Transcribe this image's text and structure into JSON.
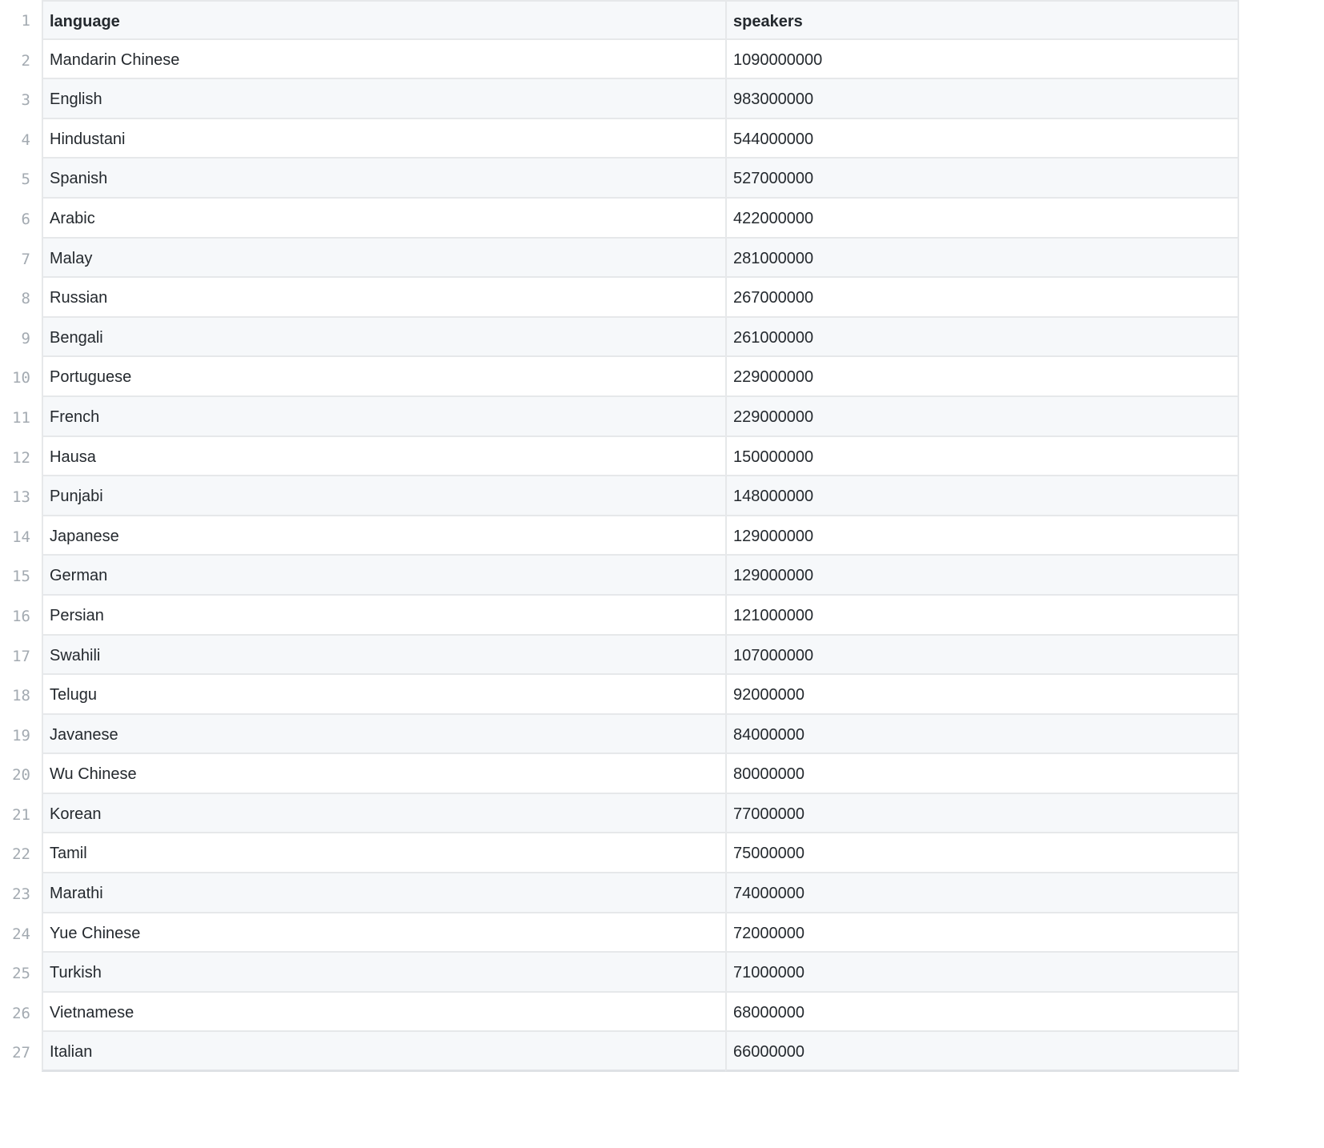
{
  "table": {
    "header": {
      "num": "1",
      "cols": [
        "language",
        "speakers"
      ]
    },
    "rows": [
      {
        "num": "2",
        "language": "Mandarin Chinese",
        "speakers": "1090000000"
      },
      {
        "num": "3",
        "language": "English",
        "speakers": "983000000"
      },
      {
        "num": "4",
        "language": "Hindustani",
        "speakers": "544000000"
      },
      {
        "num": "5",
        "language": "Spanish",
        "speakers": "527000000"
      },
      {
        "num": "6",
        "language": "Arabic",
        "speakers": "422000000"
      },
      {
        "num": "7",
        "language": "Malay",
        "speakers": "281000000"
      },
      {
        "num": "8",
        "language": "Russian",
        "speakers": "267000000"
      },
      {
        "num": "9",
        "language": "Bengali",
        "speakers": "261000000"
      },
      {
        "num": "10",
        "language": "Portuguese",
        "speakers": "229000000"
      },
      {
        "num": "11",
        "language": "French",
        "speakers": "229000000"
      },
      {
        "num": "12",
        "language": "Hausa",
        "speakers": "150000000"
      },
      {
        "num": "13",
        "language": "Punjabi",
        "speakers": "148000000"
      },
      {
        "num": "14",
        "language": "Japanese",
        "speakers": "129000000"
      },
      {
        "num": "15",
        "language": "German",
        "speakers": "129000000"
      },
      {
        "num": "16",
        "language": "Persian",
        "speakers": "121000000"
      },
      {
        "num": "17",
        "language": "Swahili",
        "speakers": "107000000"
      },
      {
        "num": "18",
        "language": "Telugu",
        "speakers": "92000000"
      },
      {
        "num": "19",
        "language": "Javanese",
        "speakers": "84000000"
      },
      {
        "num": "20",
        "language": "Wu Chinese",
        "speakers": "80000000"
      },
      {
        "num": "21",
        "language": "Korean",
        "speakers": "77000000"
      },
      {
        "num": "22",
        "language": "Tamil",
        "speakers": "75000000"
      },
      {
        "num": "23",
        "language": "Marathi",
        "speakers": "74000000"
      },
      {
        "num": "24",
        "language": "Yue Chinese",
        "speakers": "72000000"
      },
      {
        "num": "25",
        "language": "Turkish",
        "speakers": "71000000"
      },
      {
        "num": "26",
        "language": "Vietnamese",
        "speakers": "68000000"
      },
      {
        "num": "27",
        "language": "Italian",
        "speakers": "66000000"
      }
    ]
  }
}
